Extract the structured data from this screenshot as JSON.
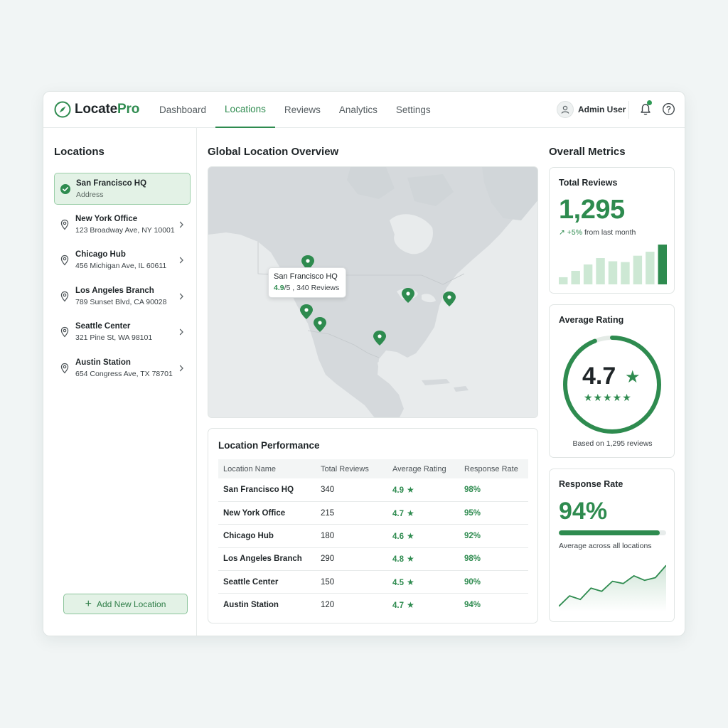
{
  "header": {
    "logo_primary": "Locate",
    "logo_accent": "Pro",
    "nav": [
      "Dashboard",
      "Locations",
      "Reviews",
      "Analytics",
      "Settings"
    ],
    "active_tab": "Locations",
    "user_name": "Admin User",
    "has_notification": true
  },
  "sidebar": {
    "title": "Locations",
    "selected": "San Francisco HQ",
    "items": [
      {
        "name": "San Francisco HQ",
        "address": "Address"
      },
      {
        "name": "New York Office",
        "address": "123 Broadway Ave, NY 10001"
      },
      {
        "name": "Chicago Hub",
        "address": "456 Michigan Ave, IL 60611"
      },
      {
        "name": "Los Angeles Branch",
        "address": "789 Sunset Blvd, CA 90028"
      },
      {
        "name": "Seattle Center",
        "address": "321 Pine St, WA 98101"
      },
      {
        "name": "Austin Station",
        "address": "654 Congress Ave, TX 78701"
      }
    ],
    "add_button": "Add New Location"
  },
  "map": {
    "title": "Global Location Overview",
    "tooltip": {
      "name": "San Francisco HQ",
      "rating": "4.9",
      "rating_scale": "/5",
      "reviews": ", 340 Reviews"
    }
  },
  "performance": {
    "title": "Location Performance",
    "columns": [
      "Location Name",
      "Total Reviews",
      "Average Rating",
      "Response Rate"
    ],
    "rows": [
      [
        "San Francisco HQ",
        "340",
        "4.9",
        "98%"
      ],
      [
        "New York Office",
        "215",
        "4.7",
        "95%"
      ],
      [
        "Chicago Hub",
        "180",
        "4.6",
        "92%"
      ],
      [
        "Los Angeles Branch",
        "290",
        "4.8",
        "98%"
      ],
      [
        "Seattle Center",
        "150",
        "4.5",
        "90%"
      ],
      [
        "Austin Station",
        "120",
        "4.7",
        "94%"
      ]
    ]
  },
  "metrics": {
    "title": "Overall Metrics",
    "total_reviews": {
      "title": "Total Reviews",
      "value": "1,295",
      "change": "+5%",
      "change_suffix": "from last month",
      "bars": [
        0.18,
        0.34,
        0.5,
        0.66,
        0.58,
        0.56,
        0.72,
        0.82,
        1.0
      ]
    },
    "average_rating": {
      "title": "Average Rating",
      "value": "4.7",
      "max": 5,
      "stars": "★★★★★",
      "based_on": "Based on 1,295 reviews"
    },
    "response_rate": {
      "title": "Response Rate",
      "value": "94%",
      "fraction": 0.94,
      "subtitle": "Average across all locations",
      "trend": [
        0.05,
        0.28,
        0.2,
        0.45,
        0.38,
        0.6,
        0.55,
        0.72,
        0.62,
        0.68,
        0.95
      ]
    }
  },
  "colors": {
    "accent": "#2e8b4f",
    "accent_light": "#e3f2e6",
    "map_land": "#d5d9dc",
    "map_water": "#e8ebec"
  }
}
